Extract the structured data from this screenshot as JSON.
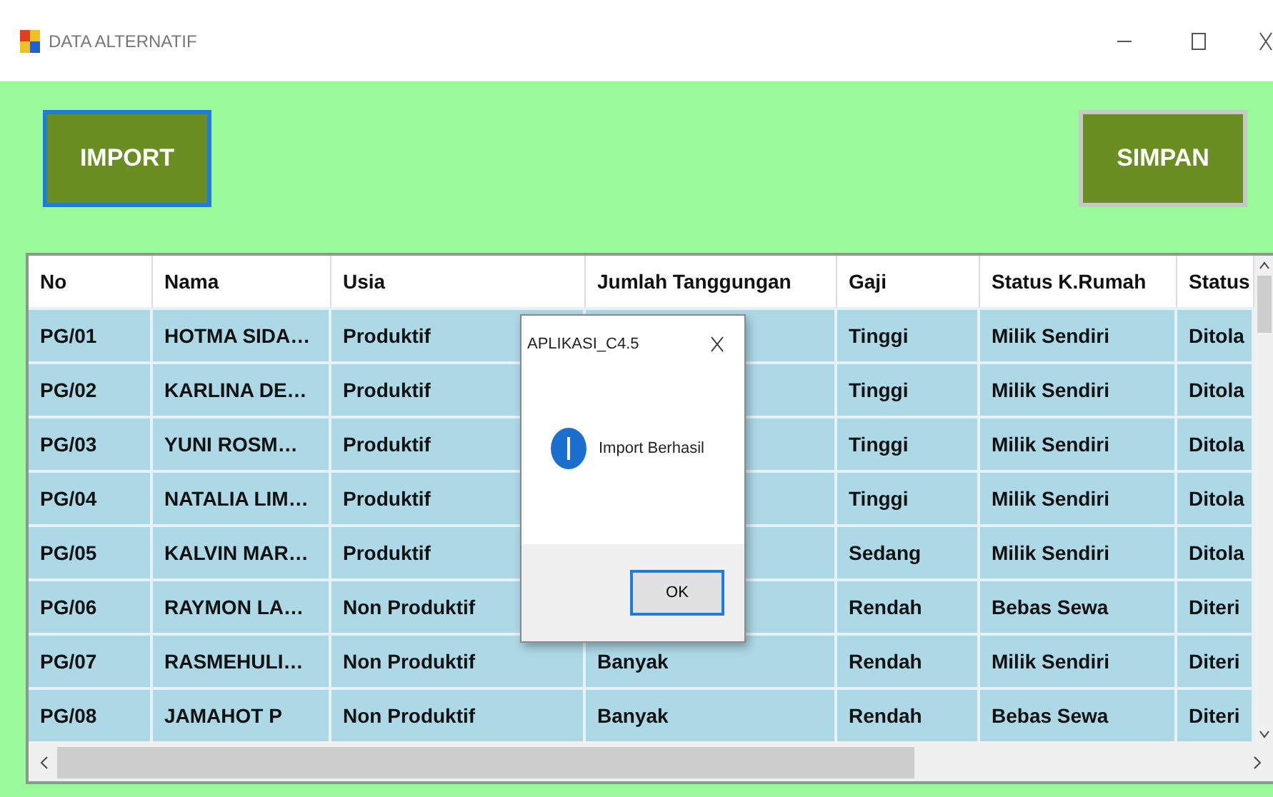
{
  "window": {
    "title": "DATA ALTERNATIF"
  },
  "buttons": [
    {
      "label": "IMPORT",
      "focused": true
    },
    {
      "label": "SIMPAN",
      "focused": false
    }
  ],
  "table": {
    "columns": [
      "No",
      "Nama",
      "Usia",
      "Jumlah Tanggungan",
      "Gaji",
      "Status K.Rumah",
      "Status"
    ],
    "rows": [
      {
        "cells": [
          "PG/01",
          "HOTMA SIDA…",
          "Produktif",
          null,
          "Tinggi",
          "Milik Sendiri",
          "Ditola"
        ]
      },
      {
        "cells": [
          "PG/02",
          "KARLINA DE…",
          "Produktif",
          null,
          "Tinggi",
          "Milik Sendiri",
          "Ditola"
        ]
      },
      {
        "cells": [
          "PG/03",
          "YUNI ROSM…",
          "Produktif",
          null,
          "Tinggi",
          "Milik Sendiri",
          "Ditola"
        ]
      },
      {
        "cells": [
          "PG/04",
          "NATALIA LIM…",
          "Produktif",
          null,
          "Tinggi",
          "Milik Sendiri",
          "Ditola"
        ]
      },
      {
        "cells": [
          "PG/05",
          "KALVIN MAR…",
          "Produktif",
          null,
          "Sedang",
          "Milik Sendiri",
          "Ditola"
        ]
      },
      {
        "cells": [
          "PG/06",
          "RAYMON LA…",
          "Non Produktif",
          null,
          "Rendah",
          "Bebas Sewa",
          "Diteri"
        ]
      },
      {
        "cells": [
          "PG/07",
          "RASMEHULI…",
          "Non Produktif",
          "Banyak",
          "Rendah",
          "Milik Sendiri",
          "Diteri"
        ]
      },
      {
        "cells": [
          "PG/08",
          "JAMAHOT P",
          "Non Produktif",
          "Banyak",
          "Rendah",
          "Bebas Sewa",
          "Diteri"
        ]
      }
    ]
  },
  "dialog": {
    "title": "APLIKASI_C4.5",
    "message": "Import Berhasil",
    "button": "OK"
  }
}
